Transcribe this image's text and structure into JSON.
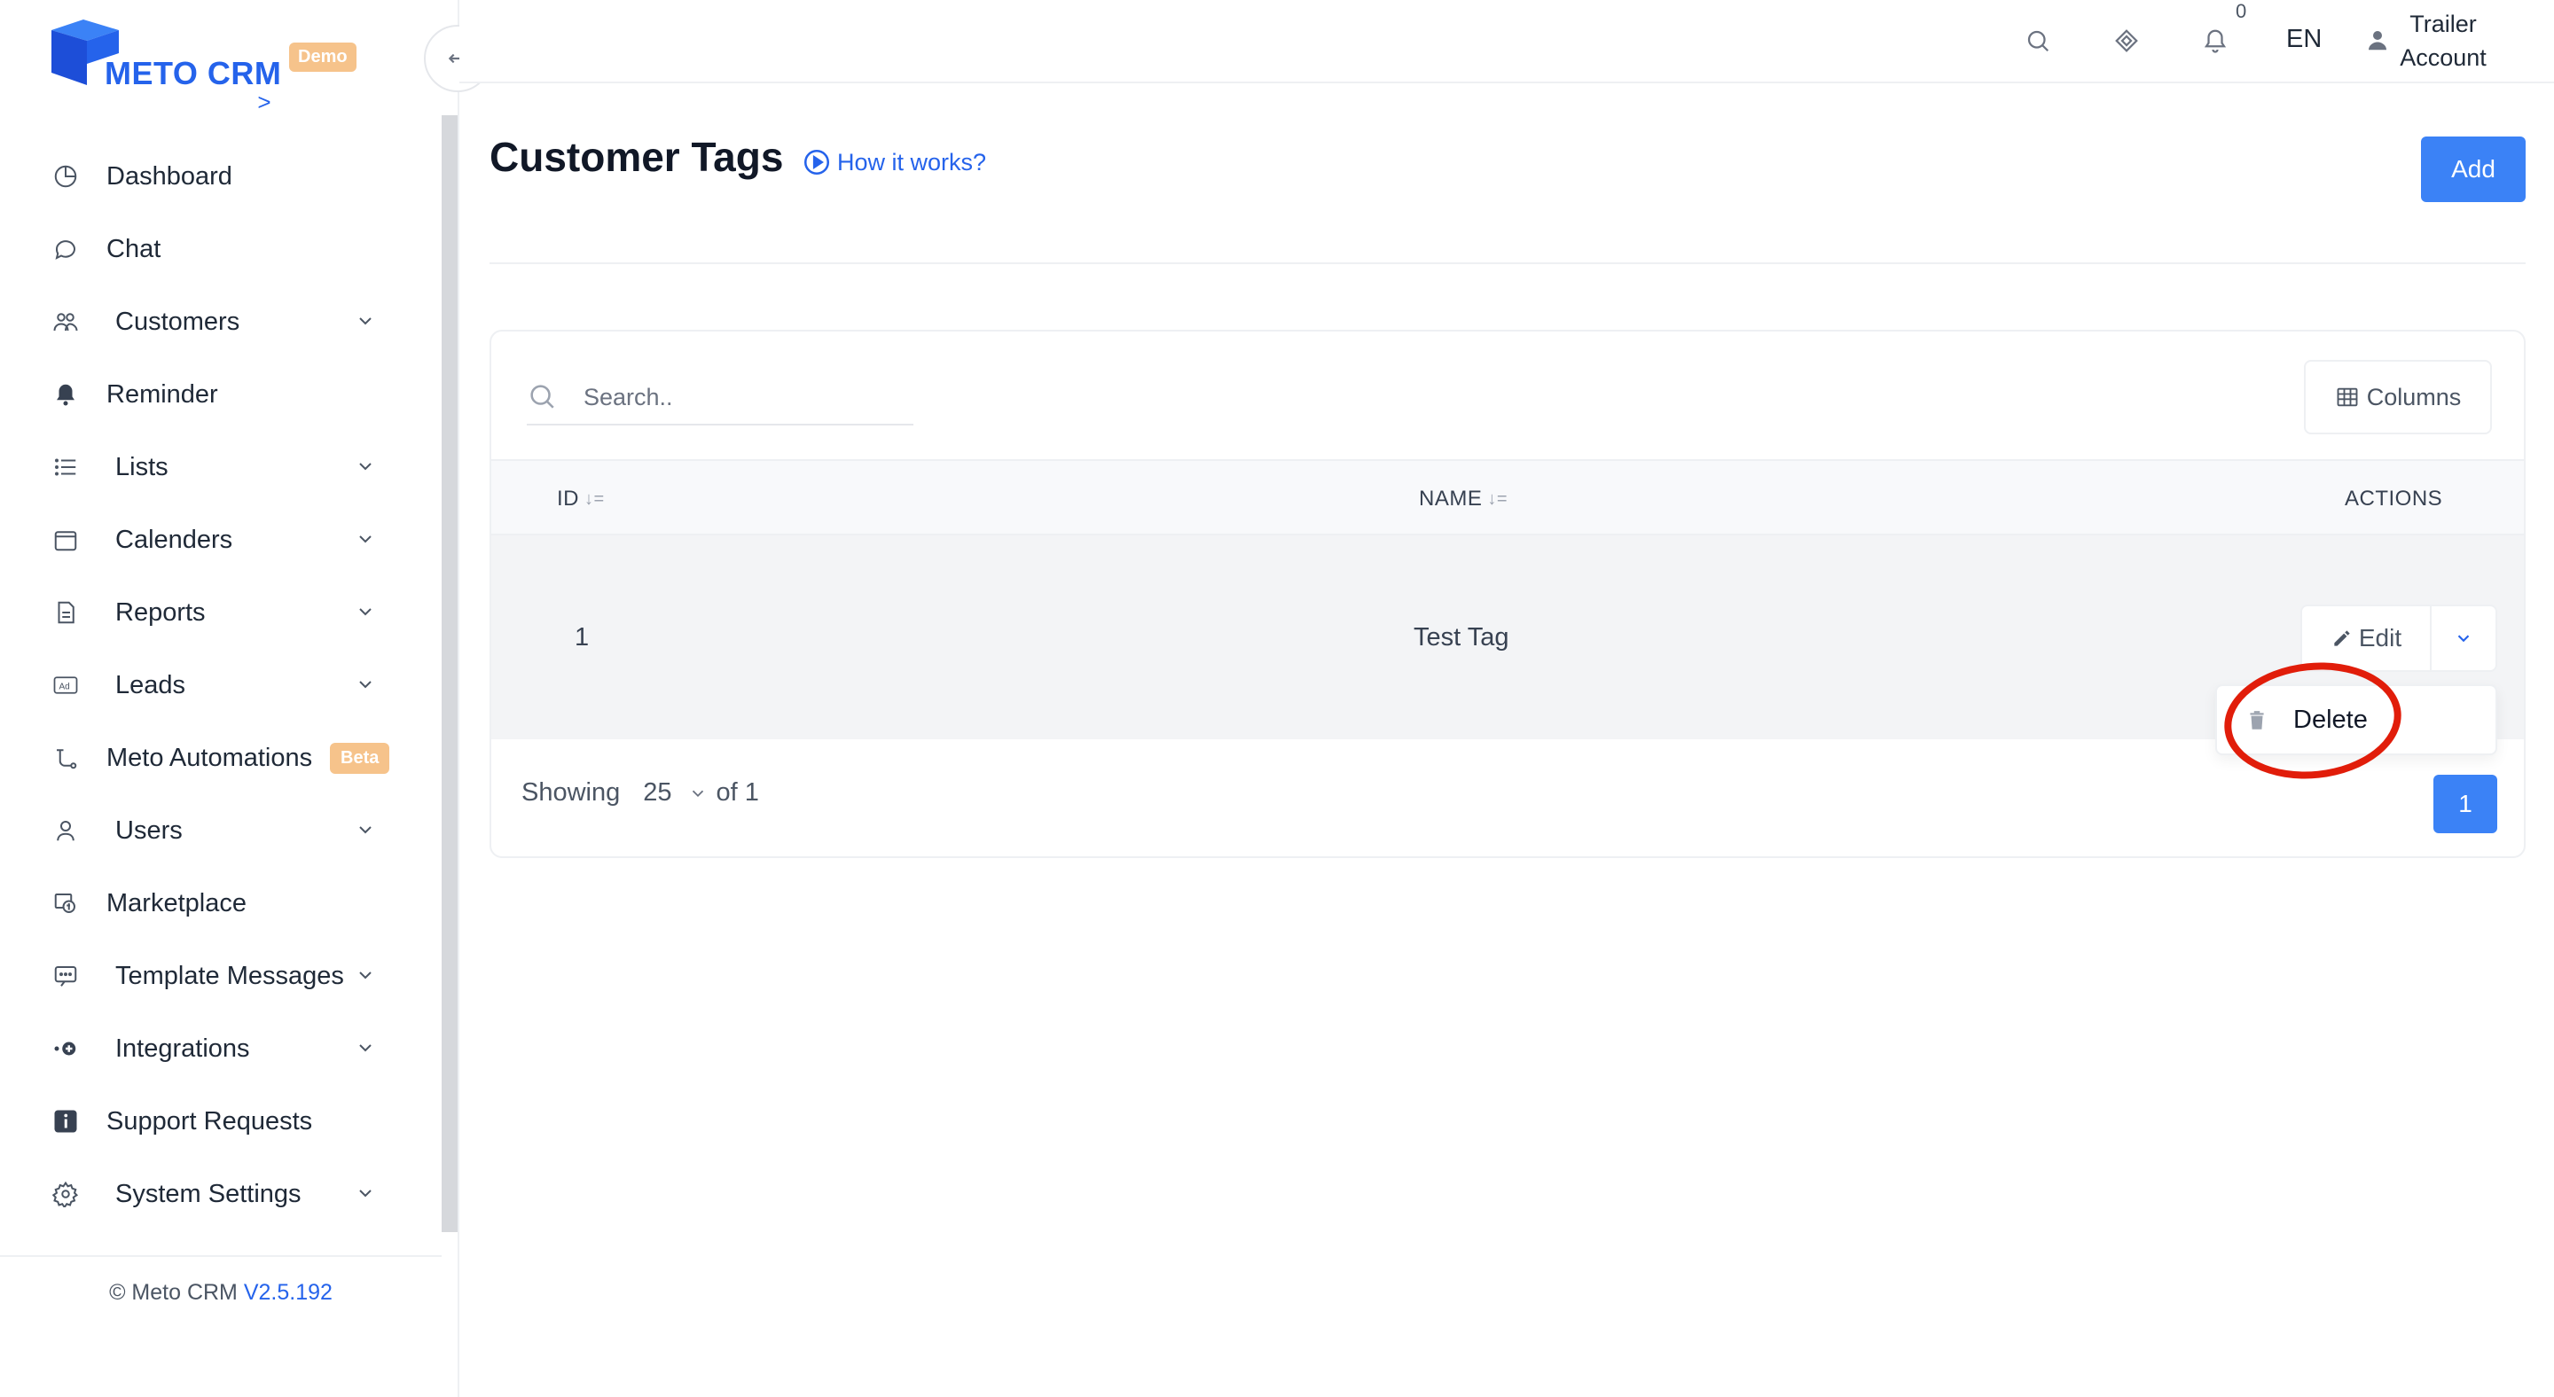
{
  "brand": {
    "name": "METO CRM",
    "badge": "Demo",
    "primary_color": "#2563eb",
    "badge_color": "#f6c38b"
  },
  "sidebar": {
    "items": [
      {
        "label": "Dashboard",
        "icon": "pie-chart-icon",
        "expandable": false
      },
      {
        "label": "Chat",
        "icon": "chat-bubble-icon",
        "expandable": false
      },
      {
        "label": "Customers",
        "icon": "users-icon",
        "expandable": true
      },
      {
        "label": "Reminder",
        "icon": "bell-icon",
        "expandable": false
      },
      {
        "label": "Lists",
        "icon": "list-icon",
        "expandable": true
      },
      {
        "label": "Calenders",
        "icon": "calendar-icon",
        "expandable": true
      },
      {
        "label": "Reports",
        "icon": "document-icon",
        "expandable": true
      },
      {
        "label": "Leads",
        "icon": "ad-icon",
        "expandable": true
      },
      {
        "label": "Meto Automations",
        "icon": "flow-icon",
        "expandable": false,
        "badge": "Beta"
      },
      {
        "label": "Users",
        "icon": "user-icon",
        "expandable": true
      },
      {
        "label": "Marketplace",
        "icon": "marketplace-icon",
        "expandable": false
      },
      {
        "label": "Template Messages",
        "icon": "message-template-icon",
        "expandable": true
      },
      {
        "label": "Integrations",
        "icon": "plug-icon",
        "expandable": true
      },
      {
        "label": "Support Requests",
        "icon": "info-icon",
        "expandable": false
      },
      {
        "label": "System Settings",
        "icon": "gear-icon",
        "expandable": true
      }
    ],
    "footer": {
      "copyright": "© Meto CRM",
      "version": "V2.5.192",
      "arrow": ">"
    }
  },
  "topbar": {
    "notification_count": "0",
    "language": "EN",
    "user_line1": "Trailer",
    "user_line2": "Account"
  },
  "page": {
    "title": "Customer Tags",
    "how_it_works": "How it works?",
    "add_button": "Add"
  },
  "table": {
    "search_placeholder": "Search..",
    "columns_button": "Columns",
    "headers": {
      "id": "ID",
      "name": "NAME",
      "actions": "ACTIONS"
    },
    "rows": [
      {
        "id": "1",
        "name": "Test Tag"
      }
    ],
    "edit_label": "Edit",
    "dropdown": {
      "delete_label": "Delete"
    },
    "pagination": {
      "showing": "Showing",
      "page_size": "25",
      "of": "of 1",
      "current_page": "1"
    }
  },
  "annotation_color": "#e11d0a"
}
